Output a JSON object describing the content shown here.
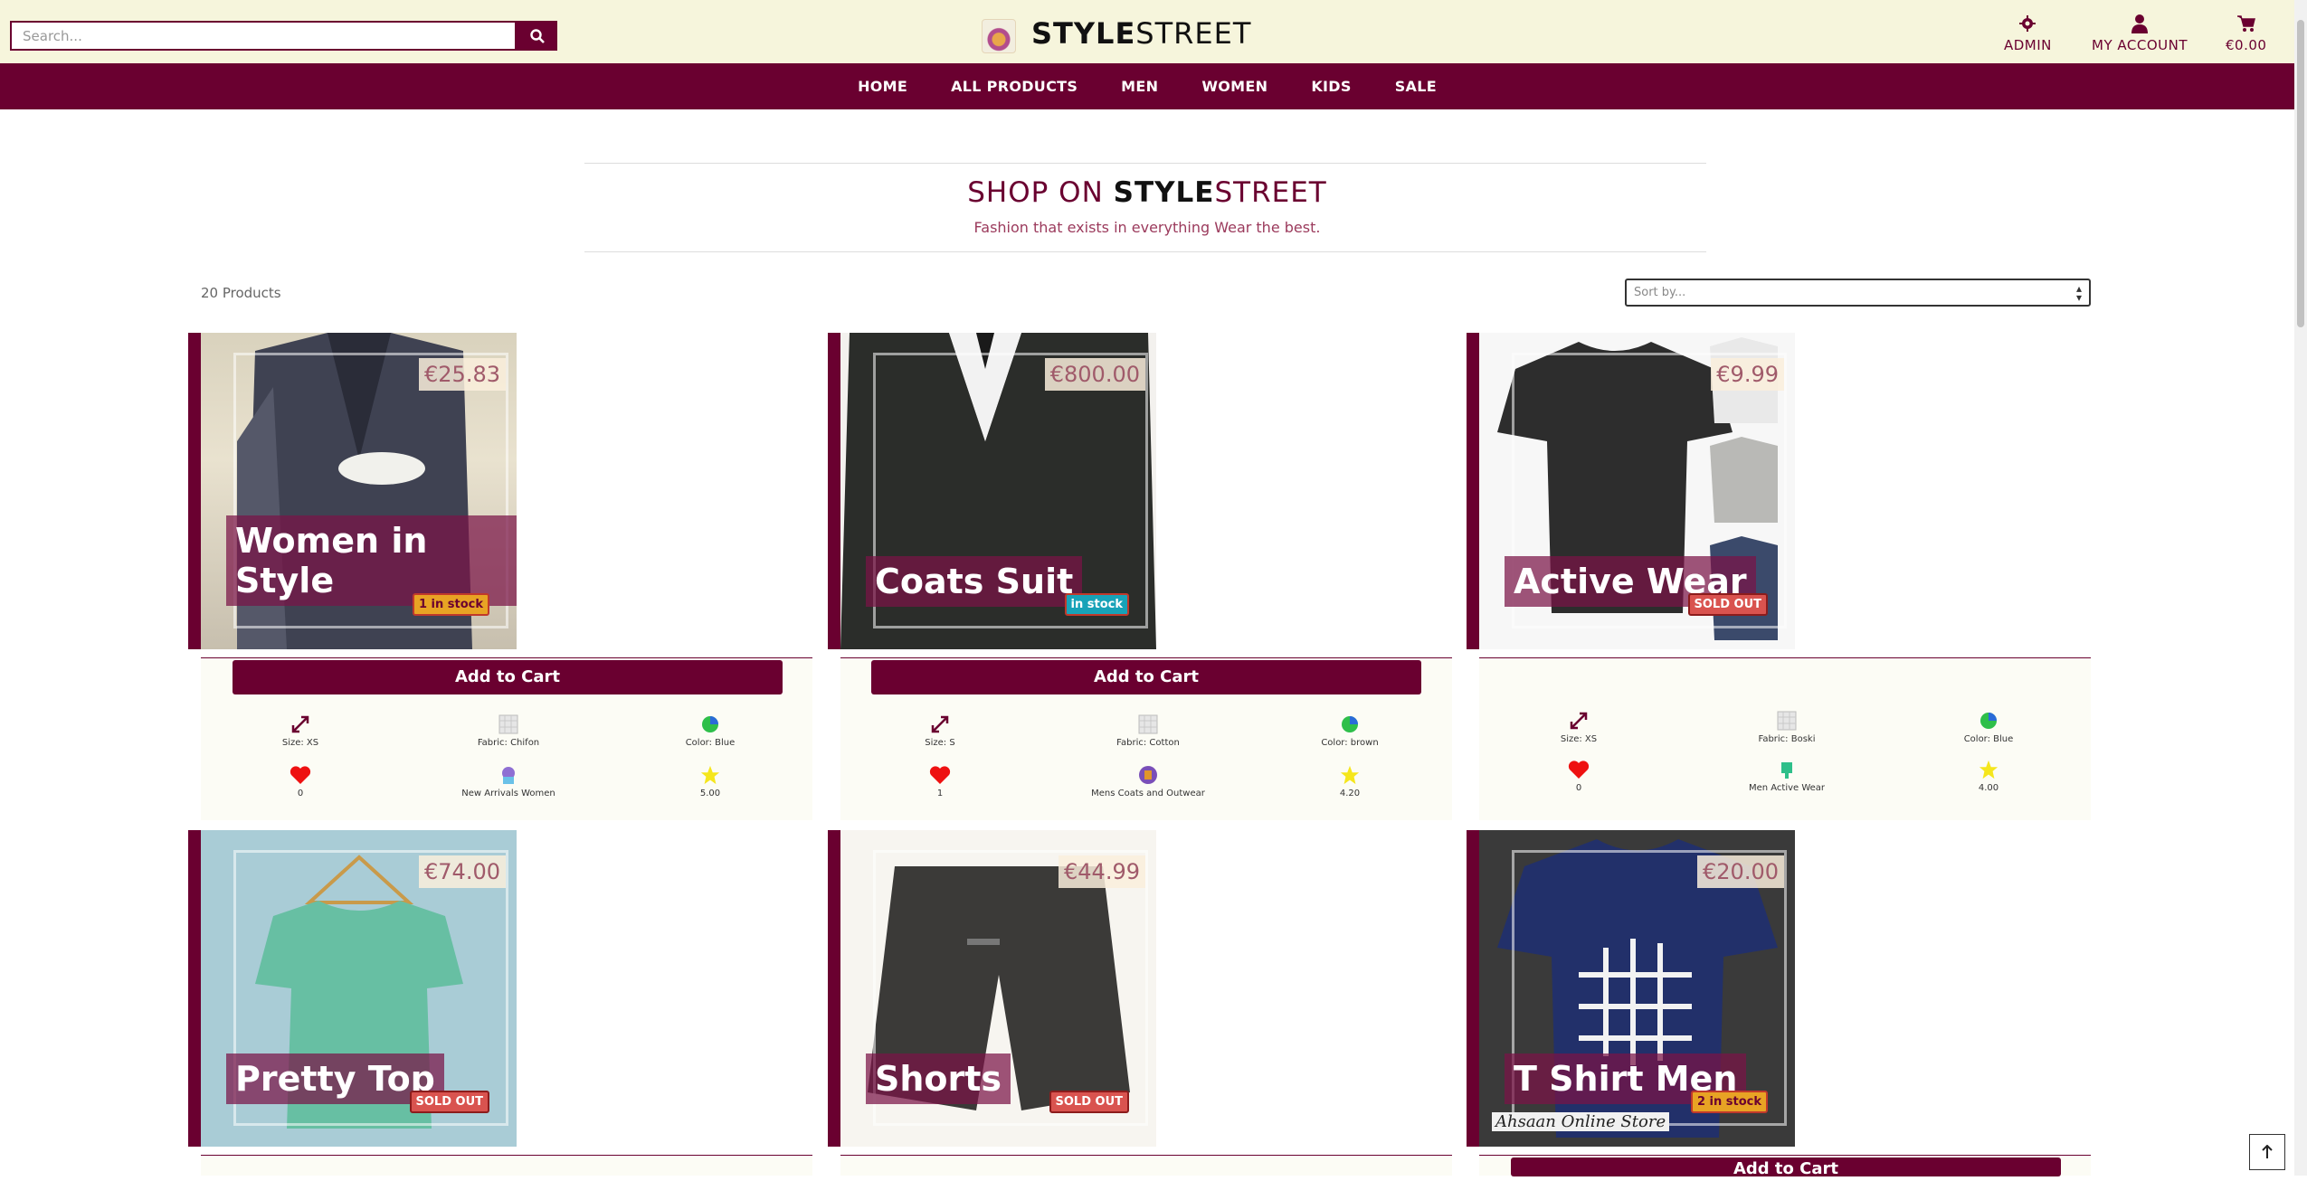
{
  "search": {
    "placeholder": "Search..."
  },
  "brand": {
    "bold": "STYLE",
    "rest": "STREET"
  },
  "utils": {
    "admin": "ADMIN",
    "account": "MY ACCOUNT",
    "cart_total": "€0.00"
  },
  "nav": [
    "HOME",
    "ALL PRODUCTS",
    "MEN",
    "WOMEN",
    "KIDS",
    "SALE"
  ],
  "header": {
    "title_prefix": "SHOP ON ",
    "title_bold": "STYLE",
    "title_rest": "STREET",
    "tagline": "Fashion that exists in everything Wear the best."
  },
  "listing": {
    "count": "20 Products",
    "sort_placeholder": "Sort by..."
  },
  "products": [
    {
      "name_line1": "Women in",
      "name_line2": "Style",
      "price": "€25.83",
      "stock": "1 in stock",
      "stock_type": "low",
      "cart": "Add to Cart",
      "size": "Size: XS",
      "fabric": "Fabric: Chifon",
      "color": "Color: Blue",
      "likes": "0",
      "category": "New Arrivals Women",
      "rating": "5.00",
      "bg": "#e9e2cf"
    },
    {
      "name_line1": "Coats Suit",
      "name_line2": "",
      "price": "€800.00",
      "stock": "in stock",
      "stock_type": "in",
      "cart": "Add to Cart",
      "size": "Size: S",
      "fabric": "Fabric: Cotton",
      "color": "Color: brown",
      "likes": "1",
      "category": "Mens Coats and Outwear",
      "rating": "4.20",
      "bg": "#2b2d2a"
    },
    {
      "name_line1": "Active Wear",
      "name_line2": "",
      "price": "€9.99",
      "stock": "SOLD OUT",
      "stock_type": "out",
      "cart": "",
      "size": "Size: XS",
      "fabric": "Fabric: Boski",
      "color": "Color: Blue",
      "likes": "0",
      "category": "Men Active Wear",
      "rating": "4.00",
      "bg": "#f4f4f4"
    },
    {
      "name_line1": "Pretty Top",
      "name_line2": "",
      "price": "€74.00",
      "stock": "SOLD OUT",
      "stock_type": "out",
      "bg": "#a9ccd6"
    },
    {
      "name_line1": "Shorts",
      "name_line2": "",
      "price": "€44.99",
      "stock": "SOLD OUT",
      "stock_type": "out",
      "bg": "#f7f5f0"
    },
    {
      "name_line1": "T Shirt Men",
      "name_line2": "",
      "price": "€20.00",
      "stock": "2 in stock",
      "stock_type": "low",
      "watermark": "Ahsaan Online Store",
      "cart": "Add to Cart",
      "bg": "#3a3a3a"
    }
  ],
  "colors": {
    "brand": "#6a0030",
    "topbar": "#f6f5dc"
  }
}
